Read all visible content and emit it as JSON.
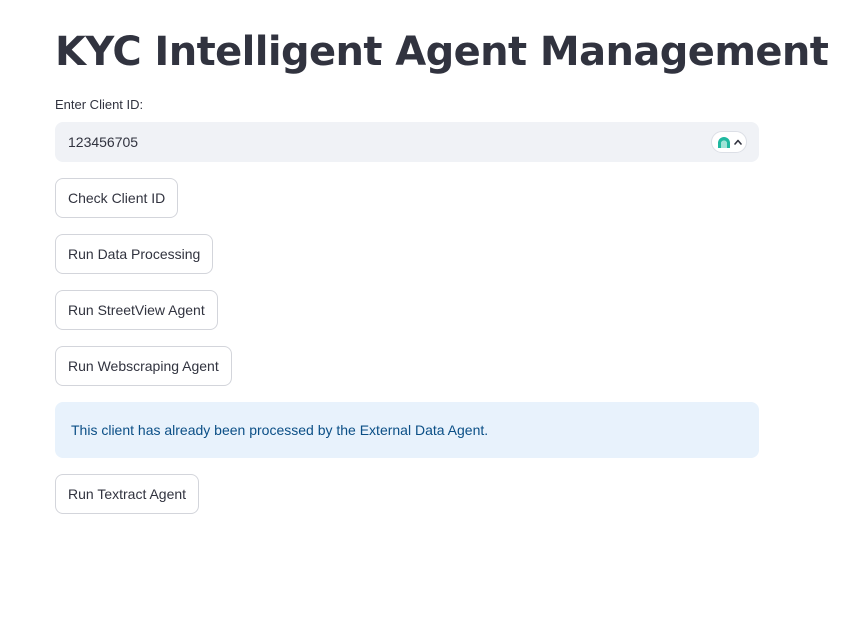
{
  "header": {
    "title": "KYC Intelligent Agent Management"
  },
  "client_id_field": {
    "label": "Enter Client ID:",
    "value": "123456705",
    "extension_icon": "teal-arch-icon",
    "extension_chevron": "chevron-up-icon"
  },
  "buttons": {
    "check_client_id": "Check Client ID",
    "run_data_processing": "Run Data Processing",
    "run_streetview_agent": "Run StreetView Agent",
    "run_webscraping_agent": "Run Webscraping Agent",
    "run_textract_agent": "Run Textract Agent"
  },
  "info_message": {
    "text": "This client has already been processed by the External Data Agent."
  },
  "colors": {
    "info_bg": "#e8f2fc",
    "info_text": "#0b4f86",
    "input_bg": "#f0f2f6",
    "extension_accent": "#20b8a0"
  }
}
